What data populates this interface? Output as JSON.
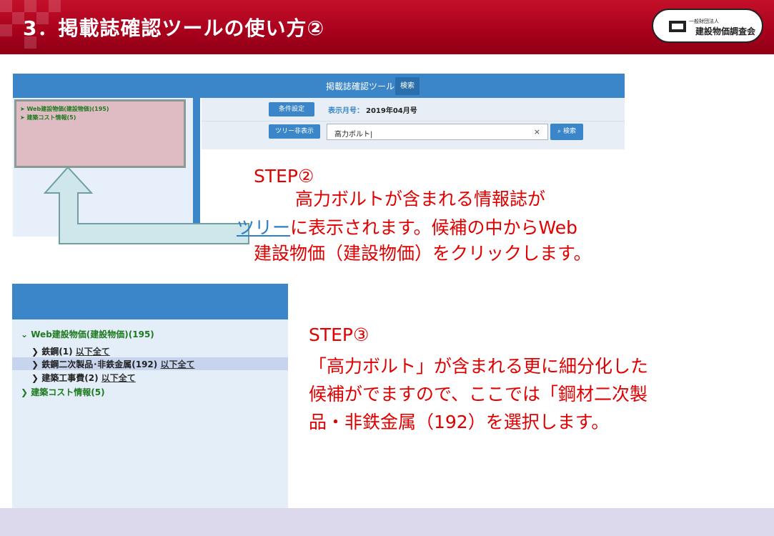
{
  "slide": {
    "title": "3．掲載誌確認ツールの使い方②",
    "logo": {
      "small_text": "一般財団法人",
      "name": "建設物価調査会"
    }
  },
  "tool_screen": {
    "header_title": "掲載誌確認ツール",
    "search_tab": "検索",
    "tree": [
      "Web建設物価(建設物価)(195)",
      "建築コスト情報(5)"
    ],
    "condition_button": "条件設定",
    "display_month_label": "表示月号：",
    "display_month_value": "2019年04月号",
    "tree_toggle_button": "ツリー非表示",
    "search_value": "高力ボルト|",
    "clear_icon": "×",
    "search_button": "検索"
  },
  "step2": {
    "heading": "STEP②",
    "line1": "高力ボルトが含まれる情報誌が",
    "line2_link": "ツリー",
    "line2_rest": "に表示されます。候補の中からWeb",
    "line3": "建設物価（建設物価）をクリックします。"
  },
  "tree_screen": {
    "root": "Web建設物価(建設物価)(195)",
    "children": [
      {
        "label": "鉄鋼(1)",
        "link": "以下全て"
      },
      {
        "label": "鉄鋼二次製品･非鉄金属(192)",
        "link": "以下全て"
      },
      {
        "label": "建築工事費(2)",
        "link": "以下全て"
      }
    ],
    "other": "建築コスト情報(5)"
  },
  "step3": {
    "heading": "STEP③",
    "line1": "「高力ボルト」が含まれる更に細分化した",
    "line2": "候補がでますので、ここでは「鋼材二次製",
    "line3": "品・非鉄金属（192）を選択します。"
  },
  "colors": {
    "header_red": "#a8001c",
    "tool_blue": "#3b86c8",
    "instruction_red": "#e00000",
    "tree_green": "#1e7a1e"
  }
}
